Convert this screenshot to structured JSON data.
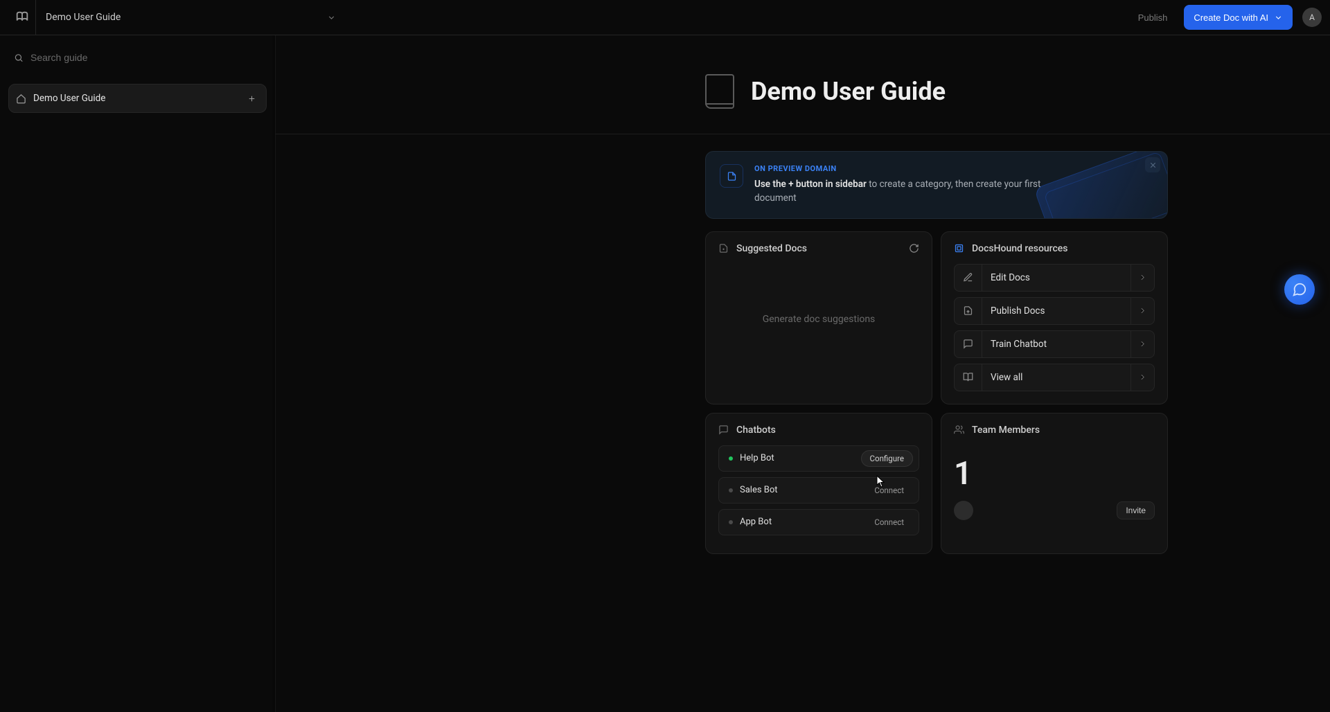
{
  "header": {
    "title": "Demo User Guide",
    "publish_label": "Publish",
    "create_label": "Create Doc with AI",
    "avatar_initial": "A"
  },
  "sidebar": {
    "search_placeholder": "Search guide",
    "root_item_label": "Demo User Guide"
  },
  "hero": {
    "title": "Demo User Guide"
  },
  "banner": {
    "tag": "ON PREVIEW DOMAIN",
    "bold": "Use the + button in sidebar",
    "rest": " to create a category, then create your first document"
  },
  "suggested": {
    "title": "Suggested Docs",
    "empty": "Generate doc suggestions"
  },
  "resources": {
    "title": "DocsHound resources",
    "items": [
      {
        "label": "Edit Docs"
      },
      {
        "label": "Publish Docs"
      },
      {
        "label": "Train Chatbot"
      },
      {
        "label": "View all"
      }
    ]
  },
  "chatbots": {
    "title": "Chatbots",
    "configure_label": "Configure",
    "connect_label": "Connect",
    "items": [
      {
        "name": "Help Bot",
        "status": "active"
      },
      {
        "name": "Sales Bot",
        "status": "inactive"
      },
      {
        "name": "App Bot",
        "status": "inactive"
      }
    ]
  },
  "team": {
    "title": "Team Members",
    "count": "1",
    "invite_label": "Invite"
  },
  "colors": {
    "accent": "#2563eb"
  }
}
